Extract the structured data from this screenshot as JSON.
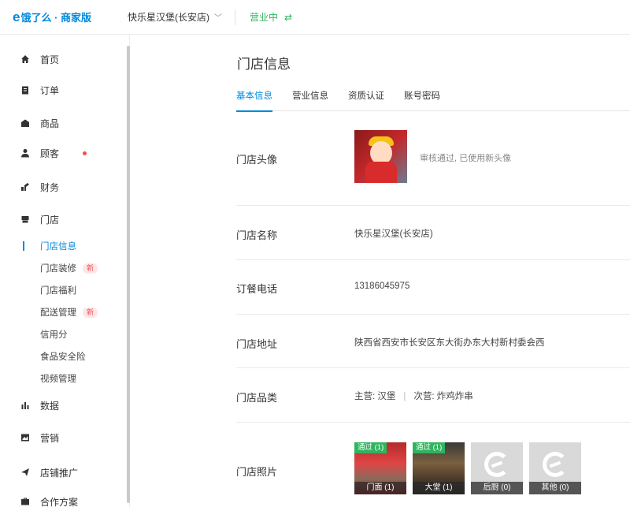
{
  "header": {
    "logo_mark": "e",
    "logo_text": "饿了么 · 商家版",
    "store_name": "快乐星汉堡(长安店)",
    "status": "营业中"
  },
  "sidebar": {
    "items": [
      {
        "label": "首页",
        "icon": "home-icon"
      },
      {
        "label": "订单",
        "icon": "clipboard-icon"
      },
      {
        "label": "商品",
        "icon": "shop-bag-icon"
      },
      {
        "label": "顾客",
        "icon": "user-icon"
      },
      {
        "label": "财务",
        "icon": "finance-icon"
      },
      {
        "label": "门店",
        "icon": "store-icon"
      },
      {
        "label": "数据",
        "icon": "bar-chart-icon"
      },
      {
        "label": "营销",
        "icon": "marketing-icon"
      },
      {
        "label": "店铺推广",
        "icon": "send-icon"
      },
      {
        "label": "合作方案",
        "icon": "briefcase-icon"
      }
    ],
    "sub_items": [
      {
        "label": "门店信息",
        "active": true
      },
      {
        "label": "门店装修",
        "badge": "新"
      },
      {
        "label": "门店福利"
      },
      {
        "label": "配送管理",
        "badge": "新"
      },
      {
        "label": "信用分"
      },
      {
        "label": "食品安全险"
      },
      {
        "label": "视频管理"
      }
    ]
  },
  "main": {
    "title": "门店信息",
    "tabs": [
      "基本信息",
      "营业信息",
      "资质认证",
      "账号密码"
    ],
    "rows": {
      "avatar": {
        "label": "门店头像",
        "note": "审核通过, 已使用新头像"
      },
      "name": {
        "label": "门店名称",
        "value": "快乐星汉堡(长安店)"
      },
      "phone": {
        "label": "订餐电话",
        "value": "13186045975"
      },
      "address": {
        "label": "门店地址",
        "value": "陕西省西安市长安区东大街办东大村新村委会西"
      },
      "category": {
        "label": "门店品类",
        "main": "主营: 汉堡",
        "sub": "次营: 炸鸡炸串"
      },
      "photos": {
        "label": "门店照片",
        "items": [
          {
            "caption": "门面 (1)",
            "status": "通过 (1)"
          },
          {
            "caption": "大堂 (1)",
            "status": "通过 (1)"
          },
          {
            "caption": "后厨 (0)"
          },
          {
            "caption": "其他 (0)"
          }
        ]
      }
    }
  }
}
